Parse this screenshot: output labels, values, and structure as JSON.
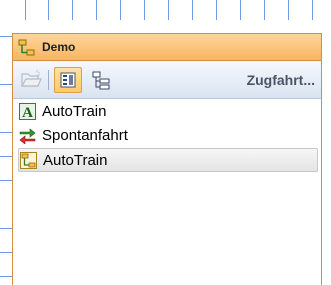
{
  "panel": {
    "title": "Demo"
  },
  "toolbar": {
    "zugfahrt_label": "Zugfahrt..."
  },
  "list": {
    "items": [
      {
        "label": "AutoTrain",
        "icon": "letter-a-icon",
        "selected": false
      },
      {
        "label": "Spontanfahrt",
        "icon": "switch-arrows-icon",
        "selected": false
      },
      {
        "label": "AutoTrain",
        "icon": "tree-node-icon",
        "selected": true
      }
    ]
  },
  "colors": {
    "title_bar": "#f7b660",
    "panel_border": "#d38f3c",
    "toolbar_bg": "#d9e3f1",
    "selected_button": "#ffc969",
    "grid_lines": "#6f9be6"
  }
}
